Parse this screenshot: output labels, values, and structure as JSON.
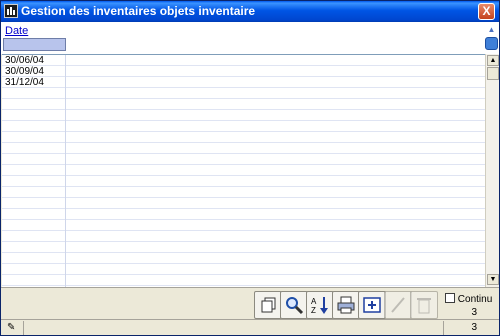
{
  "window": {
    "title": "Gestion des inventaires objets inventaire",
    "close_label": "X"
  },
  "columns": {
    "date": "Date"
  },
  "rows": [
    "30/06/04",
    "30/09/04",
    "31/12/04"
  ],
  "toolbar": {
    "buttons": [
      {
        "icon": "copy-icon",
        "enabled": true
      },
      {
        "icon": "search-icon",
        "enabled": true
      },
      {
        "icon": "sort-az-icon",
        "enabled": true
      },
      {
        "icon": "print-icon",
        "enabled": true
      },
      {
        "icon": "add-icon",
        "enabled": true
      },
      {
        "icon": "edit-icon",
        "enabled": false
      },
      {
        "icon": "delete-icon",
        "enabled": false
      }
    ],
    "continu_label": "Continu",
    "continu_checked": false,
    "count": "3"
  },
  "status": {
    "count": "3"
  },
  "colors": {
    "title_bar": "#0055e5",
    "filter_field": "#b8c4ec",
    "link": "#0000cc"
  }
}
